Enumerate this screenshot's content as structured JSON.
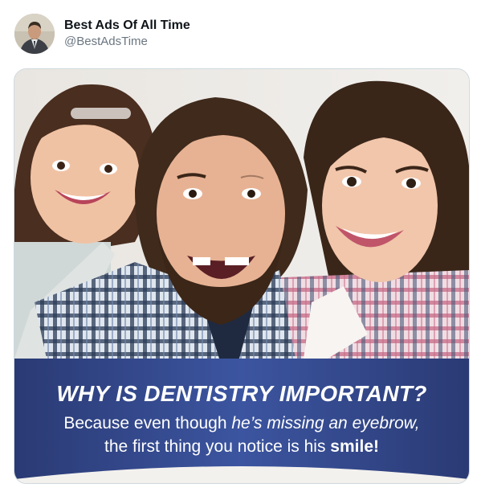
{
  "tweet": {
    "display_name": "Best Ads Of All Time",
    "handle": "@BestAdsTime"
  },
  "ad": {
    "headline": "WHY IS DENTISTRY IMPORTANT?",
    "line1_a": "Because even though ",
    "line1_b": "he’s missing an eyebrow,",
    "line2_a": "the first thing you notice is his ",
    "line2_b": "smile!",
    "banner_color": "#2c3f7a",
    "text_color": "#ffffff"
  },
  "icons": {
    "avatar": "profile-photo-icon"
  }
}
